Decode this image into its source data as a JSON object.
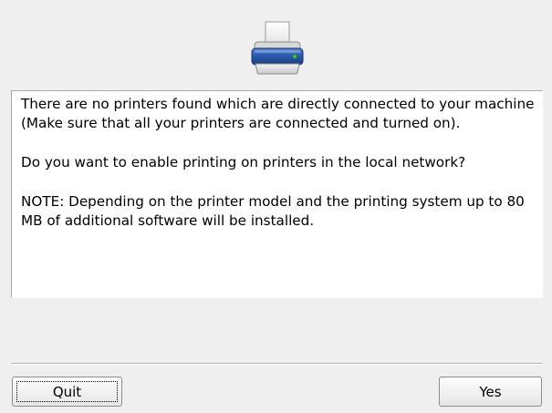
{
  "dialog": {
    "icon": "printer-icon",
    "message": {
      "paragraph1": "There are no printers found which are directly connected to your machine (Make sure that all your printers are connected and turned on).",
      "paragraph2": "Do you want to enable printing on printers in the local network?",
      "paragraph3": "NOTE: Depending on the printer model and the printing system up to 80 MB of additional software will be installed."
    },
    "buttons": {
      "quit_label": "Quit",
      "yes_label": "Yes"
    }
  },
  "colors": {
    "background": "#efefef",
    "printer_body": "#2a56a8",
    "printer_led": "#3fbf3f"
  }
}
